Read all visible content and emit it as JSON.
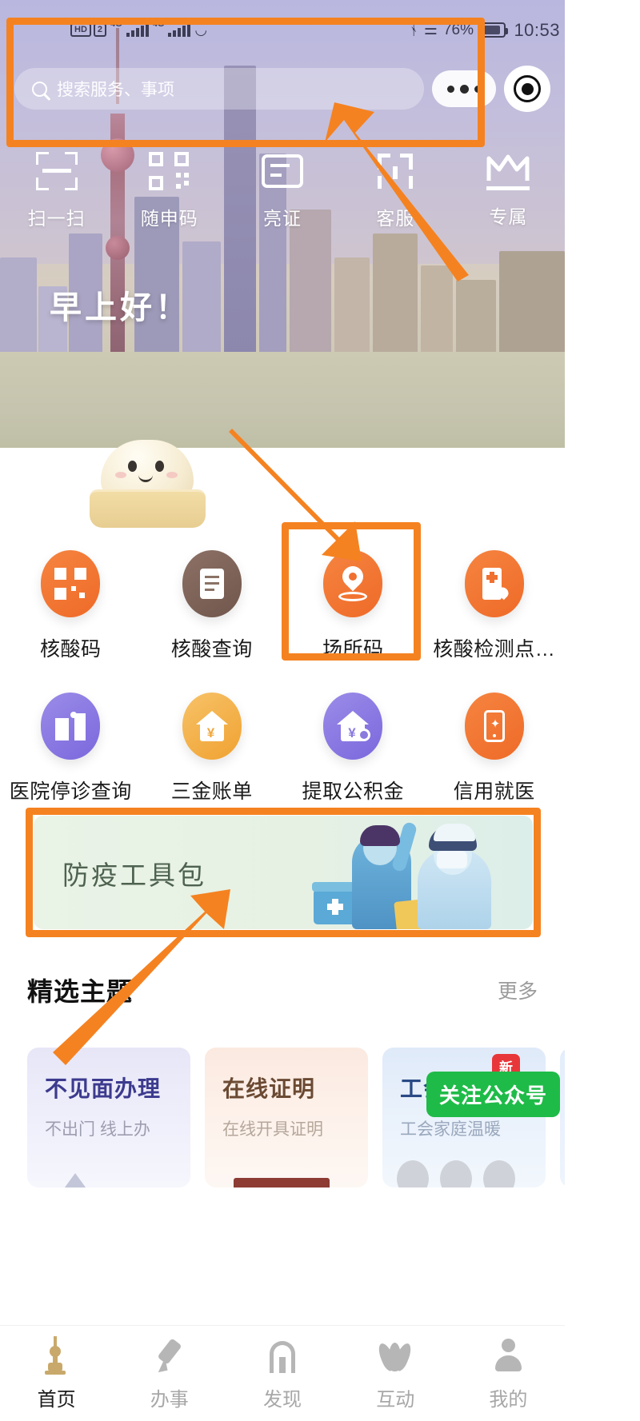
{
  "status_bar": {
    "hd_label": "HD",
    "sim_label": "2",
    "network_1": "4G",
    "network_2": "4G",
    "battery_percent": "76%",
    "clock": "10:53"
  },
  "search": {
    "placeholder": "搜索服务、事项",
    "more_icon": "ellipsis-icon",
    "target_icon": "target-icon"
  },
  "quick_actions": [
    {
      "label": "扫一扫",
      "icon": "scan-icon"
    },
    {
      "label": "随申码",
      "icon": "qr-code-icon"
    },
    {
      "label": "亮证",
      "icon": "id-card-icon"
    },
    {
      "label": "客服",
      "icon": "service-icon"
    },
    {
      "label": "专属",
      "icon": "crown-icon"
    }
  ],
  "greeting": "早上好！",
  "services": {
    "row1": [
      {
        "label": "核酸码",
        "icon": "qr-code-icon",
        "color": "#f0712f"
      },
      {
        "label": "核酸查询",
        "icon": "document-icon",
        "color": "#7d6257"
      },
      {
        "label": "场所码",
        "icon": "location-pin-icon",
        "color": "#f0712f"
      },
      {
        "label": "核酸检测点…",
        "icon": "hospital-icon",
        "color": "#f0712f"
      }
    ],
    "row2": [
      {
        "label": "医院停诊查询",
        "icon": "hospital-building-icon",
        "color": "#8a7ade"
      },
      {
        "label": "三金账单",
        "icon": "house-yuan-icon",
        "color": "#f0b04a"
      },
      {
        "label": "提取公积金",
        "icon": "house-coin-icon",
        "color": "#8a7ade"
      },
      {
        "label": "信用就医",
        "icon": "phone-sparkle-icon",
        "color": "#f0712f"
      }
    ]
  },
  "banner": {
    "title": "防疫工具包"
  },
  "section": {
    "title": "精选主题",
    "more": "更多"
  },
  "theme_cards": [
    {
      "title": "不见面办理",
      "subtitle": "不出门 线上办"
    },
    {
      "title": "在线证明",
      "subtitle": "在线开具证明"
    },
    {
      "title": "工会服务",
      "subtitle": "工会家庭温暖"
    },
    {
      "title": "",
      "subtitle": ""
    }
  ],
  "follow_badge": {
    "label": "关注公众号",
    "new_tag": "新"
  },
  "bottom_nav": [
    {
      "label": "首页",
      "icon": "tower-icon",
      "active": true
    },
    {
      "label": "办事",
      "icon": "pen-icon",
      "active": false
    },
    {
      "label": "发现",
      "icon": "arch-icon",
      "active": false
    },
    {
      "label": "互动",
      "icon": "leaf-icon",
      "active": false
    },
    {
      "label": "我的",
      "icon": "user-icon",
      "active": false
    }
  ],
  "annotations": {
    "accent_color": "#f58220",
    "boxes": [
      "search-bar-highlight",
      "venue-code-highlight",
      "epidemic-toolkit-highlight"
    ],
    "arrows": [
      "arrow-to-search-bar",
      "arrow-to-venue-code",
      "arrow-to-epidemic-toolkit"
    ]
  }
}
